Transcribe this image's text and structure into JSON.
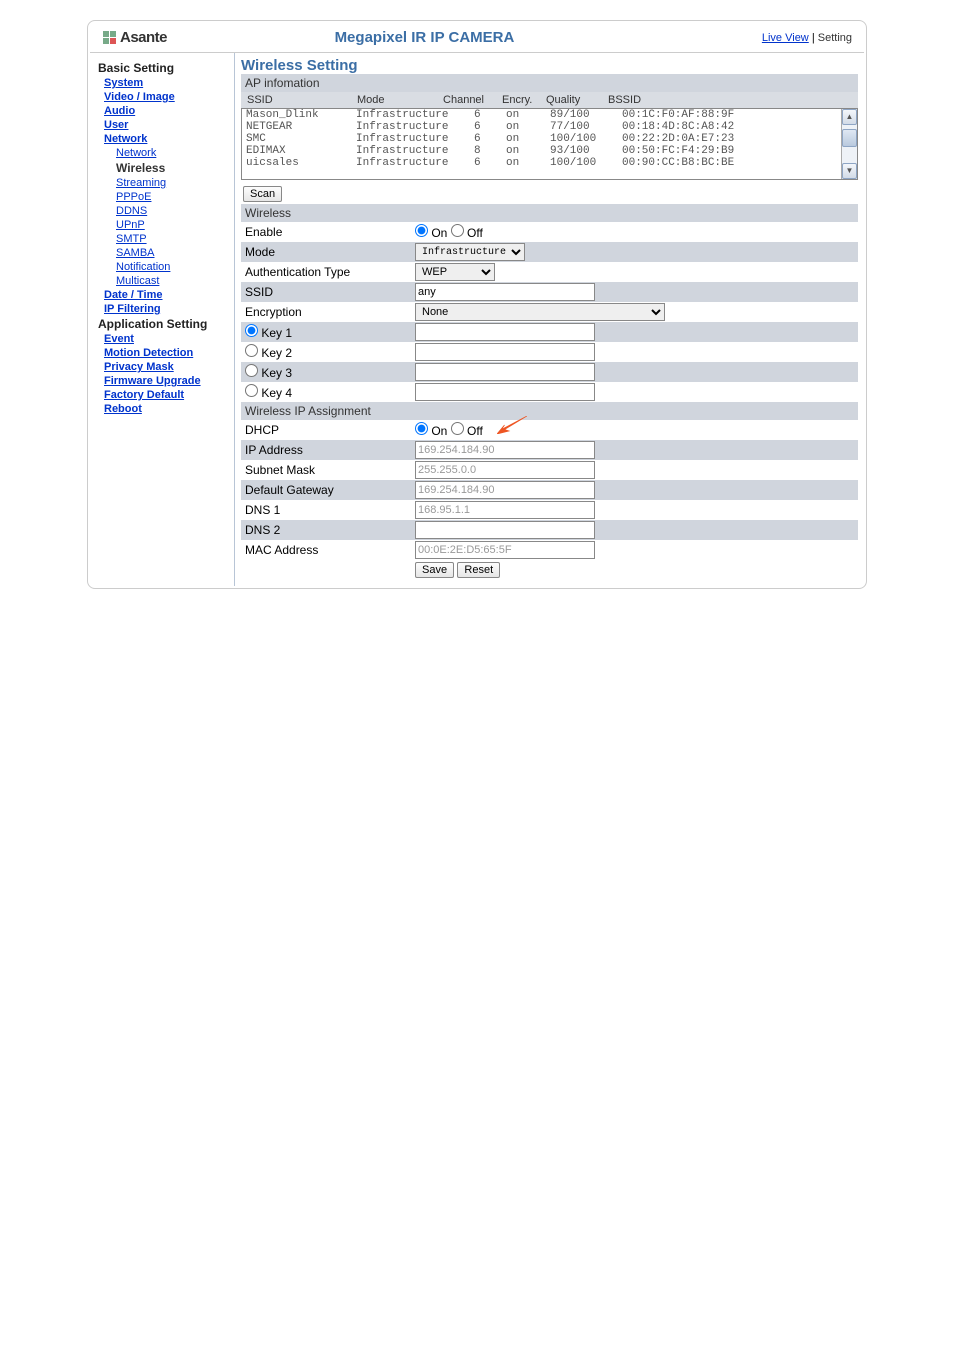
{
  "header": {
    "logo_text": "Asante",
    "title": "Megapixel IR IP CAMERA",
    "nav_live": "Live View",
    "nav_sep": " | ",
    "nav_setting": "Setting"
  },
  "sidebar": {
    "basic": "Basic Setting",
    "system": "System",
    "video": "Video / Image",
    "audio": "Audio",
    "user": "User",
    "network": "Network",
    "network2": "Network",
    "wireless": "Wireless",
    "streaming": "Streaming",
    "pppoe": "PPPoE",
    "ddns": "DDNS",
    "upnp": "UPnP",
    "smtp": "SMTP",
    "samba": "SAMBA",
    "notification": "Notification",
    "multicast": "Multicast",
    "date": "Date / Time",
    "ipfilter": "IP Filtering",
    "app": "Application Setting",
    "event": "Event",
    "motion": "Motion Detection",
    "privacy": "Privacy Mask",
    "firmware": "Firmware Upgrade",
    "factory": "Factory Default",
    "reboot": "Reboot"
  },
  "page": {
    "title": "Wireless Setting",
    "ap_info": "AP infomation",
    "ap_headers": {
      "ssid": "SSID",
      "mode": "Mode",
      "channel": "Channel",
      "encry": "Encry.",
      "quality": "Quality",
      "bssid": "BSSID"
    },
    "ap_list": [
      {
        "ssid": "Mason_Dlink",
        "mode": "Infrastructure",
        "channel": "6",
        "encry": "on",
        "quality": "89/100",
        "bssid": "00:1C:F0:AF:88:9F"
      },
      {
        "ssid": "NETGEAR",
        "mode": "Infrastructure",
        "channel": "6",
        "encry": "on",
        "quality": "77/100",
        "bssid": "00:18:4D:8C:A8:42"
      },
      {
        "ssid": "SMC",
        "mode": "Infrastructure",
        "channel": "6",
        "encry": "on",
        "quality": "100/100",
        "bssid": "00:22:2D:0A:E7:23"
      },
      {
        "ssid": "EDIMAX",
        "mode": "Infrastructure",
        "channel": "8",
        "encry": "on",
        "quality": "93/100",
        "bssid": "00:50:FC:F4:29:B9"
      },
      {
        "ssid": "uicsales",
        "mode": "Infrastructure",
        "channel": "6",
        "encry": "on",
        "quality": "100/100",
        "bssid": "00:90:CC:B8:BC:BE"
      }
    ],
    "scan": "Scan",
    "wireless_section": "Wireless",
    "enable_label": "Enable",
    "on": "On",
    "off": "Off",
    "mode_label": "Mode",
    "mode_value": "Infrastructure",
    "auth_label": "Authentication Type",
    "auth_value": "WEP",
    "ssid_label": "SSID",
    "ssid_value": "any",
    "encryption_label": "Encryption",
    "encryption_value": "None",
    "key1": "Key 1",
    "key2": "Key 2",
    "key3": "Key 3",
    "key4": "Key 4",
    "ip_section": "Wireless IP Assignment",
    "dhcp_label": "DHCP",
    "ip_label": "IP Address",
    "ip_value": "169.254.184.90",
    "mask_label": "Subnet Mask",
    "mask_value": "255.255.0.0",
    "gw_label": "Default Gateway",
    "gw_value": "169.254.184.90",
    "dns1_label": "DNS 1",
    "dns1_value": "168.95.1.1",
    "dns2_label": "DNS 2",
    "mac_label": "MAC Address",
    "mac_value": "00:0E:2E:D5:65:5F",
    "save": "Save",
    "reset": "Reset"
  }
}
